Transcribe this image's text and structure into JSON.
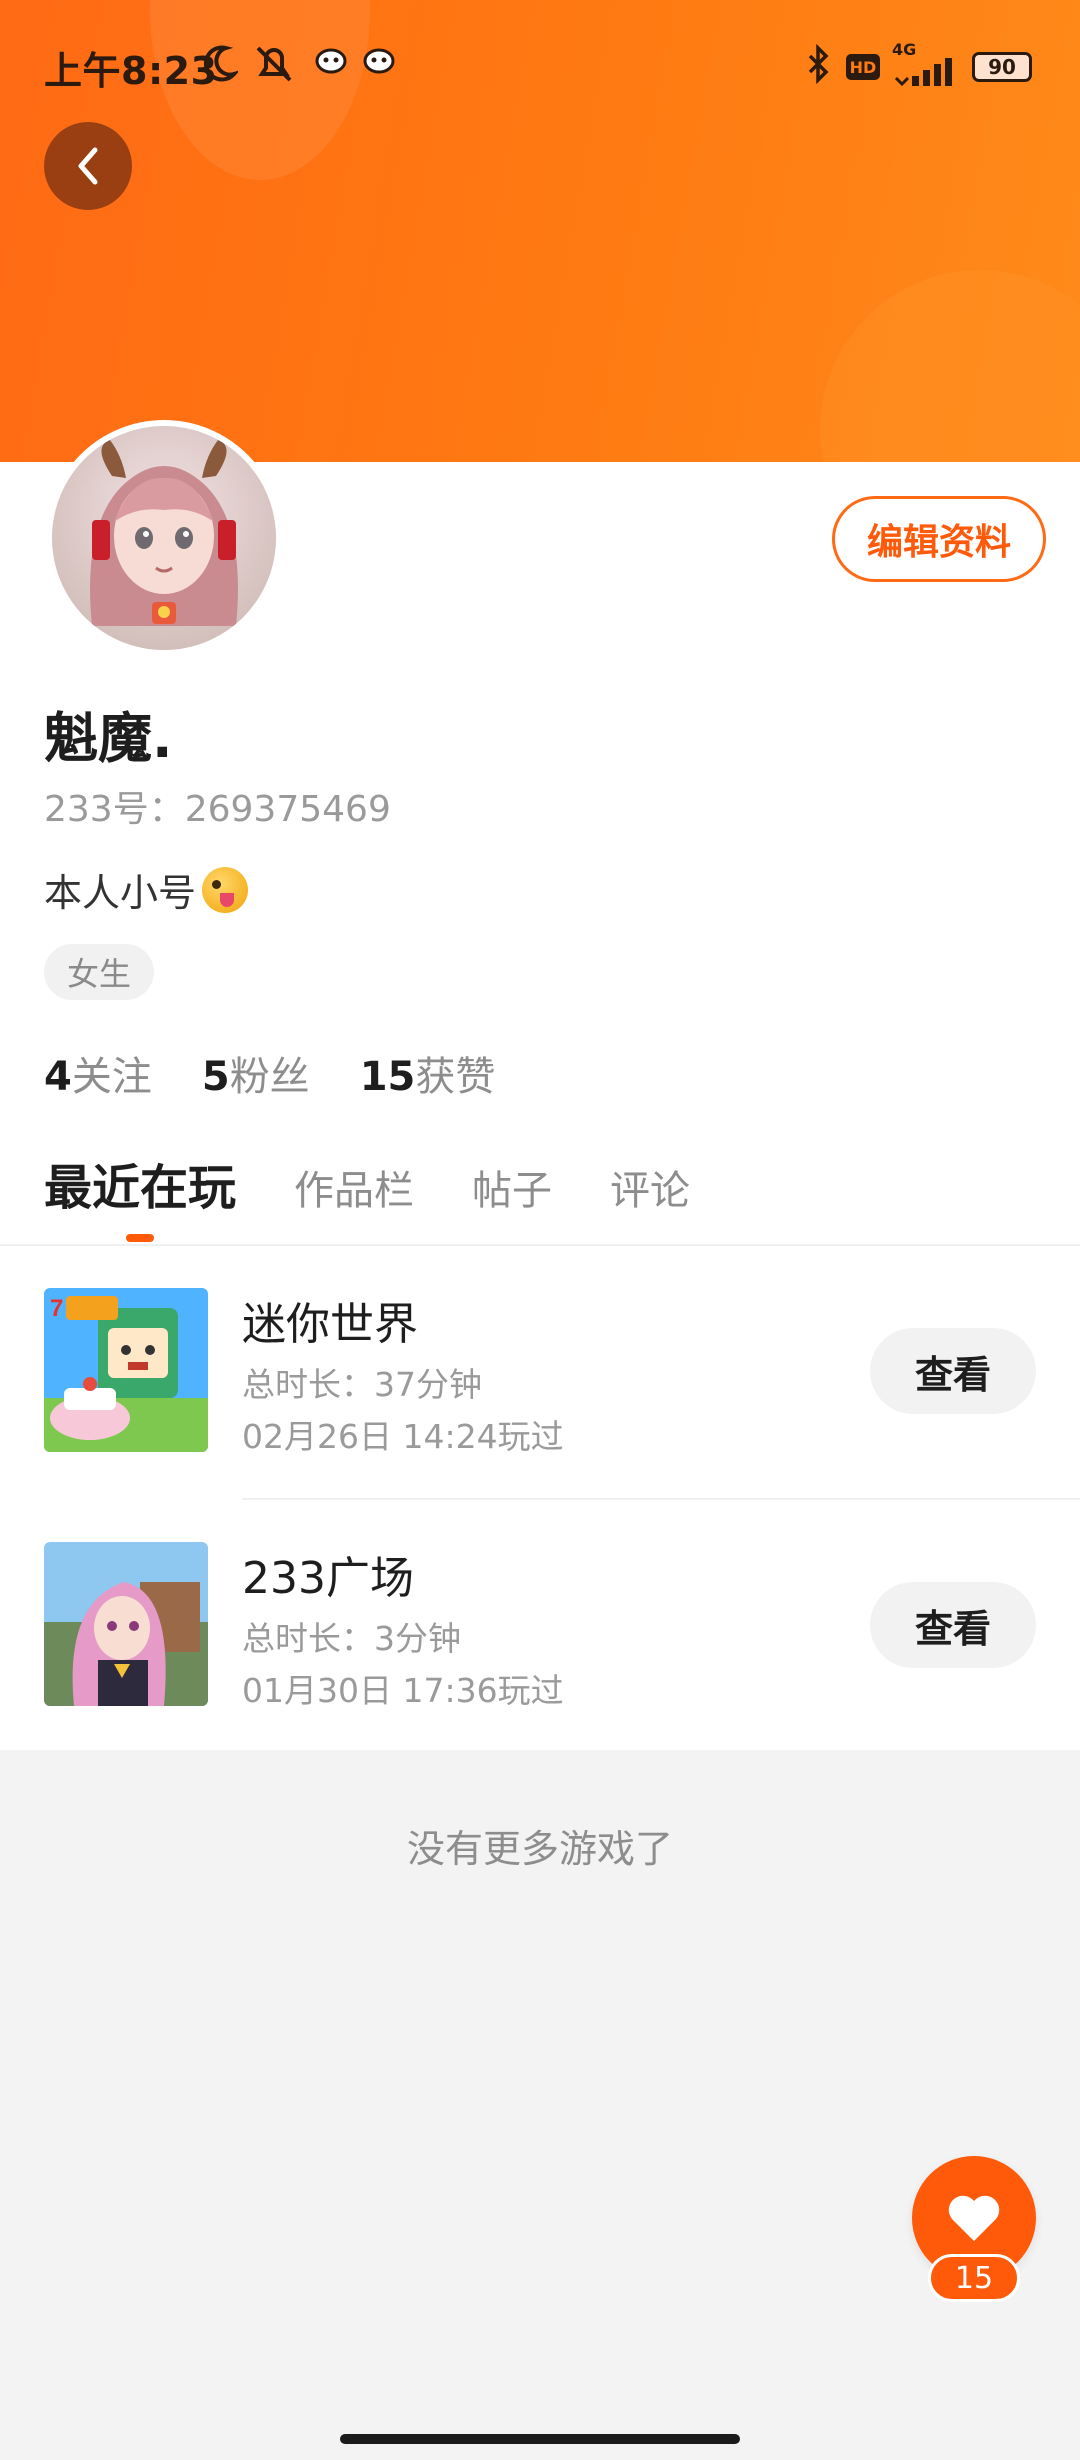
{
  "status_bar": {
    "time": "上午8:23",
    "battery": "90",
    "network": "4G",
    "hd_badge": "HD"
  },
  "header": {
    "back_icon": "chevron-left-icon",
    "edit_button_label": "编辑资料"
  },
  "profile": {
    "username": "魁魔.",
    "uid_text": "233号：269375469",
    "bio": "本人小号",
    "bio_emoji": "tongue-wink-emoji",
    "gender_tag": "女生",
    "stats": [
      {
        "count": "4",
        "label": "关注"
      },
      {
        "count": "5",
        "label": "粉丝"
      },
      {
        "count": "15",
        "label": "获赞"
      }
    ]
  },
  "tabs": [
    {
      "label": "最近在玩",
      "active": true
    },
    {
      "label": "作品栏",
      "active": false
    },
    {
      "label": "帖子",
      "active": false
    },
    {
      "label": "评论",
      "active": false
    }
  ],
  "games": [
    {
      "title": "迷你世界",
      "duration": "总时长：37分钟",
      "last_played": "02月26日 14:24玩过",
      "view_label": "查看"
    },
    {
      "title": "233广场",
      "duration": "总时长：3分钟",
      "last_played": "01月30日 17:36玩过",
      "view_label": "查看"
    }
  ],
  "footer_text": "没有更多游戏了",
  "like_fab": {
    "count": "15"
  },
  "colors": {
    "brand_orange": "#ff5a0a",
    "header_gradient_start": "#ff6a14",
    "header_gradient_end": "#ff8a1a"
  }
}
